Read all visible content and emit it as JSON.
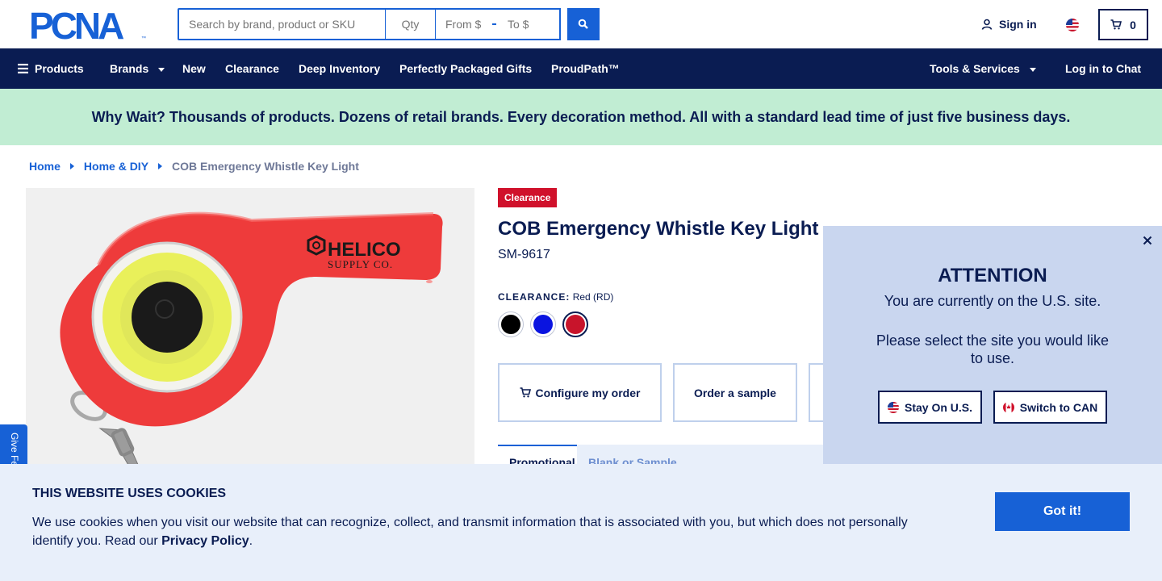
{
  "header": {
    "logo_text": "PCNA",
    "search": {
      "placeholder": "Search by brand, product or SKU"
    },
    "qty": {
      "placeholder": "Qty"
    },
    "price_from": {
      "placeholder": "From $"
    },
    "price_to": {
      "placeholder": "To $"
    },
    "signin_label": "Sign in",
    "cart_count": "0"
  },
  "nav": {
    "items": [
      "Products",
      "Brands",
      "New",
      "Clearance",
      "Deep Inventory",
      "Perfectly Packaged Gifts",
      "ProudPath™"
    ],
    "tools_label": "Tools & Services",
    "chat_label": "Log in to Chat"
  },
  "promo": {
    "text": "Why Wait? Thousands of products. Dozens of retail brands. Every decoration method. All with a standard lead time of just five business days."
  },
  "breadcrumb": {
    "items": [
      "Home",
      "Home & DIY"
    ],
    "current": "COB Emergency Whistle Key Light"
  },
  "product": {
    "badge": "Clearance",
    "title": "COB Emergency Whistle Key Light",
    "sku": "SM-9617",
    "color_label": "CLEARANCE:",
    "color_value": "Red (RD)",
    "swatches": [
      {
        "name": "Black",
        "color": "#000000"
      },
      {
        "name": "Blue",
        "color": "#0a14e0"
      },
      {
        "name": "Red",
        "color": "#c8142b"
      }
    ],
    "image_brand_line1": "HELICO",
    "image_brand_line2": "SUPPLY CO.",
    "colors": {
      "body": "#ee3b3b",
      "lens": "#e9f05a",
      "button": "#1a1a1a"
    }
  },
  "actions": {
    "configure": "Configure my order",
    "sample": "Order a sample"
  },
  "tabs": {
    "active": "Promotional",
    "inactive": "Blank or Sample"
  },
  "feedback": {
    "label": "Give Feedback"
  },
  "modal": {
    "title": "ATTENTION",
    "line1": "You are currently on the U.S. site.",
    "line2": "Please select the site you would like to use.",
    "stay": "Stay On U.S.",
    "switch": "Switch to CAN"
  },
  "cookie": {
    "title": "THIS WEBSITE USES COOKIES",
    "text_before": "We use cookies when you visit our website that can recognize, collect, and transmit information that is associated with you, but which does not personally identify you. Read our ",
    "link": "Privacy Policy",
    "text_after": ".",
    "button": "Got it!"
  },
  "colors": {
    "navy": "#0a1c52",
    "accent": "#1761d6",
    "promo_bg": "#c1edd3",
    "badge": "#d0112b"
  }
}
